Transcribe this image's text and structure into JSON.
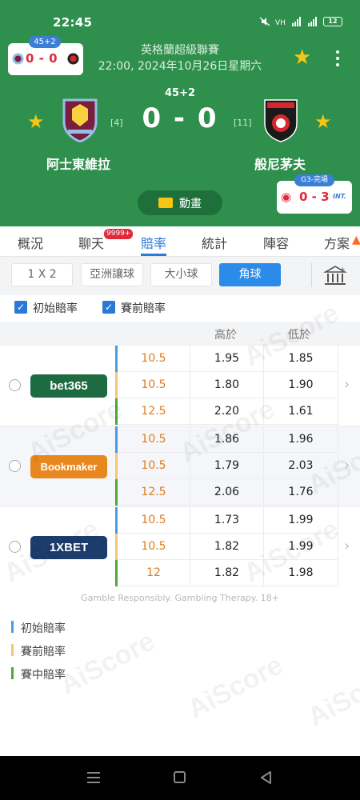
{
  "status_bar": {
    "time": "22:45",
    "battery": "12"
  },
  "header": {
    "mini_card": {
      "badge": "45+2",
      "score": "0 - 0"
    },
    "league": "英格蘭超級聯賽",
    "datetime": "22:00, 2024年10月26日星期六",
    "extra_time": "45+2",
    "score": "0 - 0",
    "home": {
      "name": "阿士東維拉",
      "rank": "[4]"
    },
    "away": {
      "name": "般尼茅夫",
      "rank": "[11]"
    },
    "animation_label": "動畫",
    "weibo_card": {
      "badge": "G3-完場",
      "score": "0 - 3",
      "tag": "INT."
    }
  },
  "tabs": [
    "概況",
    "聊天",
    "賠率",
    "統計",
    "陣容",
    "方案"
  ],
  "active_tab": "賠率",
  "chat_badge": "9999+",
  "filters": [
    "1 X 2",
    "亞洲讓球",
    "大小球",
    "角球"
  ],
  "active_filter": "角球",
  "checkboxes": {
    "initial": "初始賠率",
    "prematch": "賽前賠率"
  },
  "table_header": {
    "over": "高於",
    "under": "低於"
  },
  "bookmakers": [
    {
      "name": "bet365",
      "color": "#1d6b41",
      "rows": [
        {
          "line": "10.5",
          "over": "1.95",
          "under": "1.85"
        },
        {
          "line": "10.5",
          "over": "1.80",
          "under": "1.90"
        },
        {
          "line": "12.5",
          "over": "2.20",
          "under": "1.61"
        }
      ]
    },
    {
      "name": "Bookmaker",
      "color": "#e8871e",
      "rows": [
        {
          "line": "10.5",
          "over": "1.86",
          "under": "1.96"
        },
        {
          "line": "10.5",
          "over": "1.79",
          "under": "2.03"
        },
        {
          "line": "12.5",
          "over": "2.06",
          "under": "1.76"
        }
      ]
    },
    {
      "name": "1XBET",
      "color": "#1c3c6e",
      "rows": [
        {
          "line": "10.5",
          "over": "1.73",
          "under": "1.99"
        },
        {
          "line": "10.5",
          "over": "1.82",
          "under": "1.99"
        },
        {
          "line": "12",
          "over": "1.82",
          "under": "1.98"
        }
      ]
    }
  ],
  "row_colors": [
    "#4a9be0",
    "#f5c67a",
    "#4ea83a"
  ],
  "footer_note": "Gamble Responsibly. Gambling Therapy. 18+",
  "legend": [
    {
      "label": "初始賠率",
      "color": "#4a9be0"
    },
    {
      "label": "賽前賠率",
      "color": "#f5c67a"
    },
    {
      "label": "賽中賠率",
      "color": "#4ea83a"
    }
  ],
  "watermark": "AiScore"
}
